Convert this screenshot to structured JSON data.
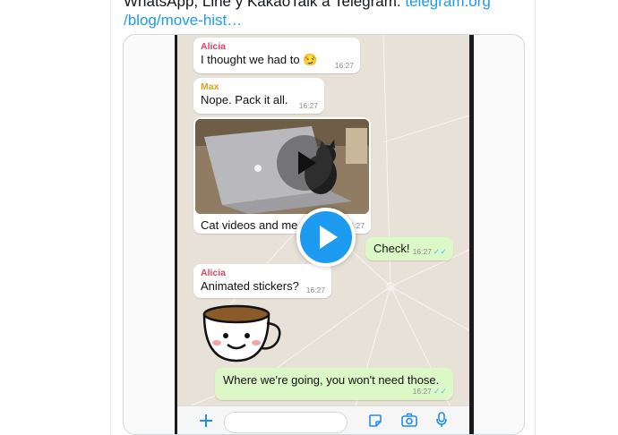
{
  "tweet": {
    "text_line1": "WhatsApp, Line y KakaoTalk a Telegram: ",
    "link_part1": "telegram.org",
    "link_part2": "/blog/move-hist…"
  },
  "chat": {
    "messages": [
      {
        "sender": "Alicia",
        "sender_color": "#e0435e",
        "text": "I thought we had to 😏",
        "time": "16:27"
      },
      {
        "sender": "Max",
        "sender_color": "#e8a21c",
        "text": "Nope. Pack it all.",
        "time": "16:27"
      },
      {
        "text": "Cat videos and me",
        "time": "16:27",
        "attachment": "video"
      },
      {
        "text": "Check!",
        "time": "16:27",
        "outgoing": true,
        "read": "✓✓"
      },
      {
        "sender": "Alicia",
        "sender_color": "#e0435e",
        "text": "Animated stickers?",
        "time": "16:27"
      },
      {
        "attachment": "sticker",
        "sticker": "smiling-coffee-cup"
      },
      {
        "text": "Where we're going, you won't need those.",
        "time": "16:27",
        "outgoing": true,
        "read": "✓✓"
      }
    ],
    "input_bar": {
      "icons": [
        "plus-icon",
        "sticker-icon",
        "camera-icon",
        "microphone-icon"
      ]
    }
  },
  "colors": {
    "accent": "#1d9bf0",
    "outgoing_bubble": "#dcf8c6",
    "chat_background": "#e7e1d7",
    "read_ticks": "#4fc3f7"
  }
}
